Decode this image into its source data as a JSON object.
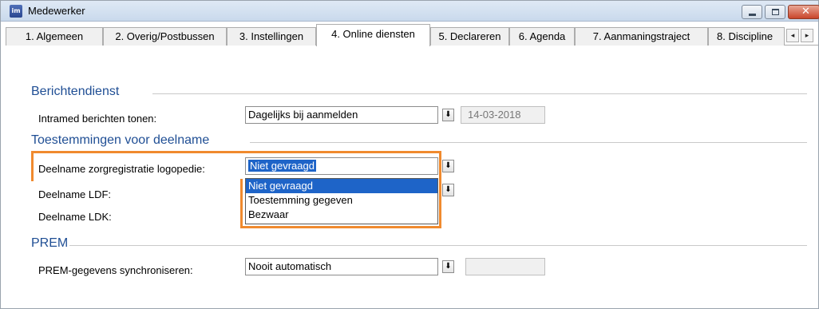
{
  "window": {
    "title": "Medewerker",
    "app_icon_text": "im"
  },
  "tabs": [
    {
      "label": "1. Algemeen",
      "active": false
    },
    {
      "label": "2. Overig/Postbussen",
      "active": false
    },
    {
      "label": "3. Instellingen",
      "active": false
    },
    {
      "label": "4. Online diensten",
      "active": true
    },
    {
      "label": "5. Declareren",
      "active": false
    },
    {
      "label": "6. Agenda",
      "active": false
    },
    {
      "label": "7. Aanmaningstraject",
      "active": false
    },
    {
      "label": "8. Discipline",
      "active": false
    }
  ],
  "icons": {
    "scroll_left": "◂",
    "scroll_right": "▸",
    "dropdown_arrow": "⬇",
    "close": "✕"
  },
  "sections": {
    "berichtendienst": {
      "title": "Berichtendienst",
      "fields": [
        {
          "label": "Intramed berichten tonen:",
          "value": "Dagelijks bij aanmelden",
          "date": "14-03-2018"
        }
      ]
    },
    "toestemmingen": {
      "title": "Toestemmingen voor deelname",
      "fields": [
        {
          "label": "Deelname zorgregistratie logopedie:",
          "value": "Niet gevraagd"
        },
        {
          "label": "Deelname LDF:",
          "value": ""
        },
        {
          "label": "Deelname LDK:",
          "value": ""
        }
      ],
      "dropdown_options": [
        "Niet gevraagd",
        "Toestemming gegeven",
        "Bezwaar"
      ],
      "dropdown_selected_index": 0
    },
    "prem": {
      "title": "PREM",
      "fields": [
        {
          "label": "PREM-gegevens synchroniseren:",
          "value": "Nooit automatisch",
          "date": ""
        }
      ]
    }
  },
  "colors": {
    "section_title": "#1f4e94",
    "highlight": "#f08a2e",
    "selection": "#1e64c8"
  }
}
